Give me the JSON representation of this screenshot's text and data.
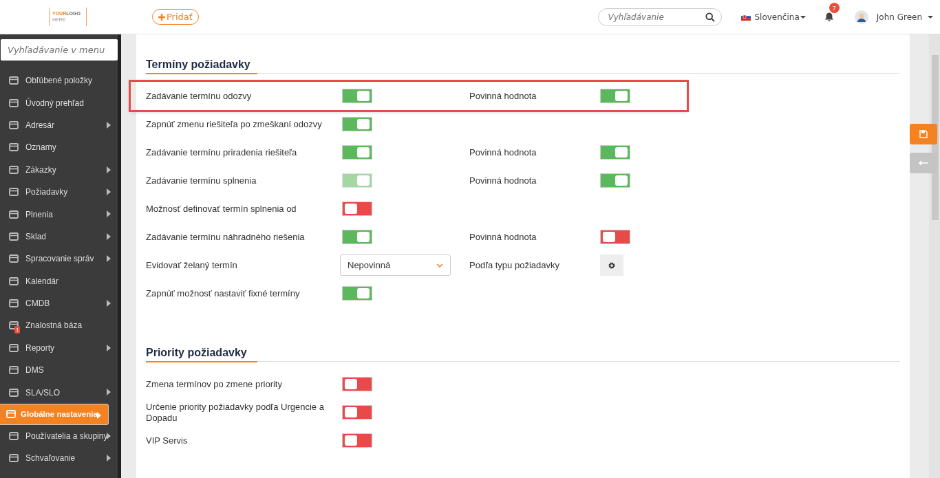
{
  "header": {
    "logo_top_left": "YOUR",
    "logo_top_right": "LOGO",
    "logo_bottom": "HERE",
    "add_button": "Pridať",
    "search": {
      "placeholder": "Vyhľadávanie"
    },
    "language": "Slovenčina",
    "notifications": "7",
    "user": "John Green"
  },
  "sidebar": {
    "search": {
      "placeholder": "Vyhľadávanie v menu"
    },
    "items": [
      {
        "label": "Obľúbené položky",
        "submenu": false,
        "selected": false
      },
      {
        "label": "Úvodný prehľad",
        "submenu": false,
        "selected": false
      },
      {
        "label": "Adresár",
        "submenu": true,
        "selected": false
      },
      {
        "label": "Oznamy",
        "submenu": false,
        "selected": false
      },
      {
        "label": "Zákazky",
        "submenu": true,
        "selected": false
      },
      {
        "label": "Požiadavky",
        "submenu": true,
        "selected": false
      },
      {
        "label": "Plnenia",
        "submenu": true,
        "selected": false
      },
      {
        "label": "Sklad",
        "submenu": true,
        "selected": false
      },
      {
        "label": "Spracovanie správ",
        "submenu": true,
        "selected": false
      },
      {
        "label": "Kalendár",
        "submenu": false,
        "selected": false
      },
      {
        "label": "CMDB",
        "submenu": true,
        "selected": false
      },
      {
        "label": "Znalostná báza",
        "submenu": false,
        "selected": false,
        "badge": "1"
      },
      {
        "label": "Reporty",
        "submenu": true,
        "selected": false
      },
      {
        "label": "DMS",
        "submenu": false,
        "selected": false
      },
      {
        "label": "SLA/SLO",
        "submenu": true,
        "selected": false
      },
      {
        "label": "Globálne nastavenia",
        "submenu": true,
        "selected": true
      },
      {
        "label": "Používatelia a skupiny",
        "submenu": true,
        "selected": false
      },
      {
        "label": "Schvaľovanie",
        "submenu": true,
        "selected": false
      }
    ]
  },
  "sections": [
    {
      "title": "Termíny požiadavky",
      "rows": [
        {
          "label": "Zadávanie termínu odozvy",
          "kind": "toggle",
          "on": true,
          "disabled": false,
          "highlighted": true,
          "extra": {
            "label": "Povinná hodnota",
            "kind": "toggle",
            "on": true,
            "disabled": false
          }
        },
        {
          "label": "Zapnúť zmenu riešiteľa po zmeškaní odozvy",
          "kind": "toggle",
          "on": true,
          "disabled": false
        },
        {
          "label": "Zadávanie termínu priradenia riešiteľa",
          "kind": "toggle",
          "on": true,
          "disabled": false,
          "extra": {
            "label": "Povinná hodnota",
            "kind": "toggle",
            "on": true,
            "disabled": false
          }
        },
        {
          "label": "Zadávanie termínu splnenia",
          "kind": "toggle",
          "on": true,
          "disabled": true,
          "extra": {
            "label": "Povinná hodnota",
            "kind": "toggle",
            "on": true,
            "disabled": false
          }
        },
        {
          "label": "Možnosť definovať termín splnenia od",
          "kind": "toggle",
          "on": false,
          "disabled": false
        },
        {
          "label": "Zadávanie termínu náhradného riešenia",
          "kind": "toggle",
          "on": true,
          "disabled": false,
          "extra": {
            "label": "Povinná hodnota",
            "kind": "toggle",
            "on": false,
            "disabled": false
          }
        },
        {
          "label": "Evidovať želaný termín",
          "kind": "select",
          "value": "Nepovinná",
          "extra": {
            "label": "Podľa typu požiadavky",
            "kind": "settings"
          }
        },
        {
          "label": "Zapnúť možnosť nastaviť fixné termíny",
          "kind": "toggle",
          "on": true,
          "disabled": false
        }
      ]
    },
    {
      "title": "Priority požiadavky",
      "rows": [
        {
          "label": "Zmena termínov po zmene priority",
          "kind": "toggle",
          "on": false,
          "disabled": false
        },
        {
          "label": "Určenie priority požiadavky podľa Urgencie a Dopadu",
          "kind": "toggle",
          "on": false,
          "disabled": false
        },
        {
          "label": "VIP Servis",
          "kind": "toggle",
          "on": false,
          "disabled": false
        }
      ]
    }
  ]
}
